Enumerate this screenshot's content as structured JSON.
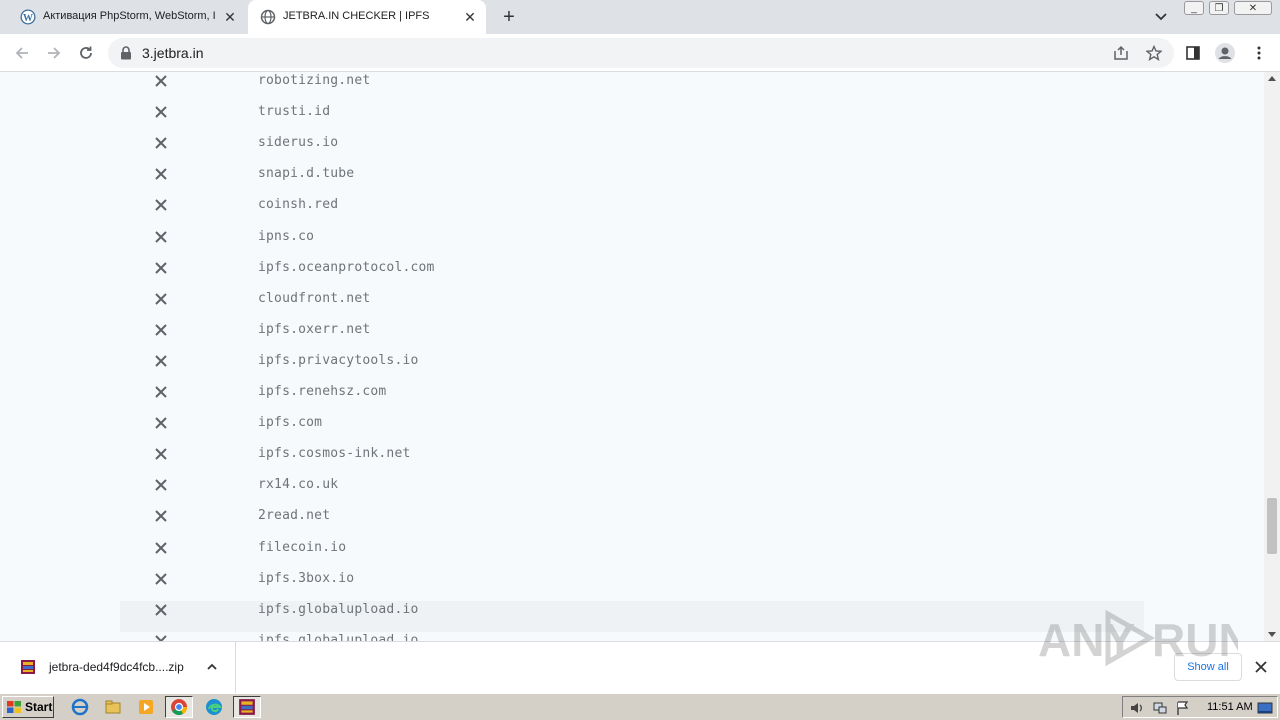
{
  "browser": {
    "tabs": [
      {
        "title": "Активация PhpStorm, WebStorm, Ir",
        "active": false,
        "favicon": "wordpress-icon"
      },
      {
        "title": "JETBRA.IN CHECKER | IPFS",
        "active": true,
        "favicon": "globe-icon"
      }
    ],
    "url": "3.jetbra.in"
  },
  "page": {
    "status_icon": "x-icon",
    "rows": [
      {
        "domain": "robotizing.net",
        "status": "fail"
      },
      {
        "domain": "trusti.id",
        "status": "fail"
      },
      {
        "domain": "siderus.io",
        "status": "fail"
      },
      {
        "domain": "snapi.d.tube",
        "status": "fail"
      },
      {
        "domain": "coinsh.red",
        "status": "fail"
      },
      {
        "domain": "ipns.co",
        "status": "fail"
      },
      {
        "domain": "ipfs.oceanprotocol.com",
        "status": "fail"
      },
      {
        "domain": "cloudfront.net",
        "status": "fail"
      },
      {
        "domain": "ipfs.oxerr.net",
        "status": "fail"
      },
      {
        "domain": "ipfs.privacytools.io",
        "status": "fail"
      },
      {
        "domain": "ipfs.renehsz.com",
        "status": "fail"
      },
      {
        "domain": "ipfs.com",
        "status": "fail"
      },
      {
        "domain": "ipfs.cosmos-ink.net",
        "status": "fail"
      },
      {
        "domain": "rx14.co.uk",
        "status": "fail"
      },
      {
        "domain": "2read.net",
        "status": "fail"
      },
      {
        "domain": "filecoin.io",
        "status": "fail"
      },
      {
        "domain": "ipfs.3box.io",
        "status": "fail"
      },
      {
        "domain": "ipfs.globalupload.io",
        "status": "fail"
      },
      {
        "domain": "ipfs.globalupload.io",
        "status": "fail"
      }
    ]
  },
  "downloads": {
    "file_name": "jetbra-ded4f9dc4fcb....zip",
    "show_all_label": "Show all"
  },
  "watermark": "ANY RUN",
  "taskbar": {
    "start_label": "Start",
    "clock": "11:51 AM"
  },
  "colors": {
    "page_bg": "#f7fafc",
    "row_highlight": "#eef2f5",
    "domain_text": "#6f7478",
    "x_icon": "#5f6368",
    "link_blue": "#1a73e8"
  }
}
